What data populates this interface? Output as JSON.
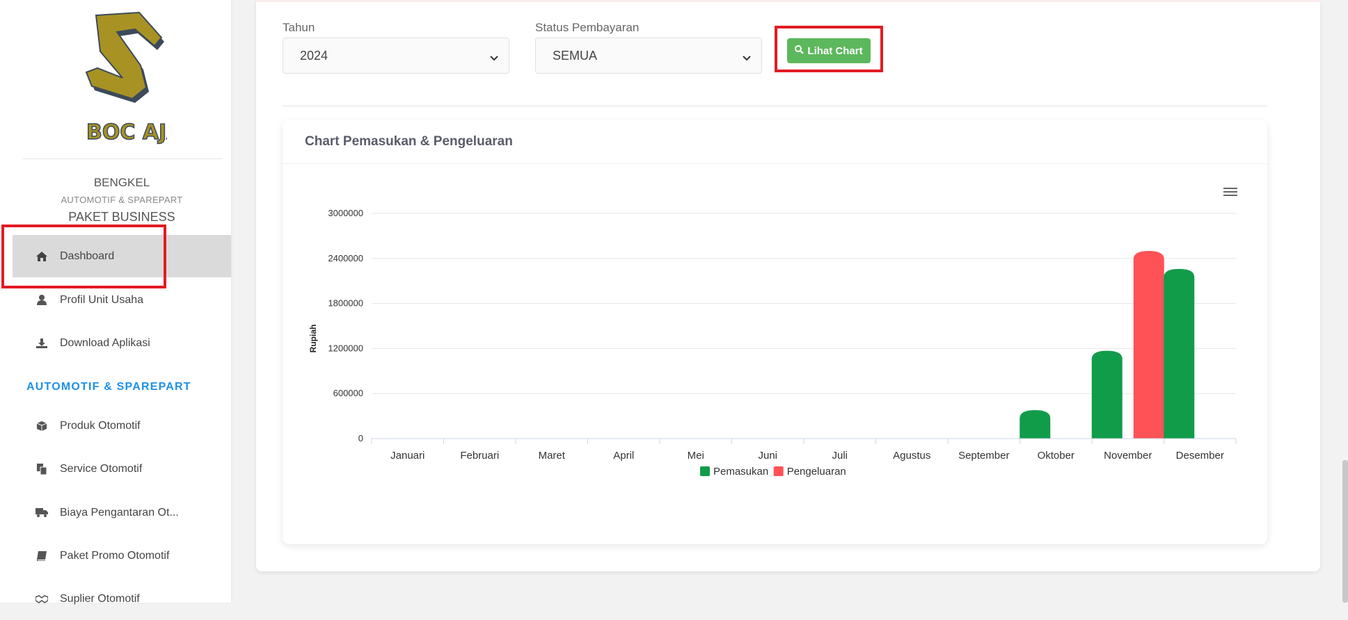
{
  "sidebar": {
    "brand": {
      "name": "BENGKEL",
      "sub": "AUTOMOTIF & SPAREPART",
      "package": "PAKET BUSINESS",
      "logo_text": "BOC AJA"
    },
    "items": [
      {
        "label": "Dashboard",
        "icon": "home-icon"
      },
      {
        "label": "Profil Unit Usaha",
        "icon": "user-icon"
      },
      {
        "label": "Download Aplikasi",
        "icon": "download-icon"
      }
    ],
    "section_title": "AUTOMOTIF & SPAREPART",
    "section_items": [
      {
        "label": "Produk Otomotif",
        "icon": "box-icon"
      },
      {
        "label": "Service Otomotif",
        "icon": "copy-icon"
      },
      {
        "label": "Biaya Pengantaran Ot...",
        "icon": "truck-icon"
      },
      {
        "label": "Paket Promo Otomotif",
        "icon": "book-icon"
      },
      {
        "label": "Suplier Otomotif",
        "icon": "handshake-icon"
      }
    ]
  },
  "filters": {
    "year_label": "Tahun",
    "year_value": "2024",
    "status_label": "Status Pembayaran",
    "status_value": "SEMUA",
    "button_label": "Lihat Chart"
  },
  "chart_card": {
    "title": "Chart Pemasukan & Pengeluaran"
  },
  "chart_data": {
    "type": "bar",
    "categories": [
      "Januari",
      "Februari",
      "Maret",
      "April",
      "Mei",
      "Juni",
      "Juli",
      "Agustus",
      "September",
      "Oktober",
      "November",
      "Desember"
    ],
    "series": [
      {
        "name": "Pemasukan",
        "color": "#119c4a",
        "values": [
          0,
          0,
          0,
          0,
          0,
          0,
          0,
          0,
          0,
          380000,
          1170000,
          2260000
        ]
      },
      {
        "name": "Pengeluaran",
        "color": "#fe5256",
        "values": [
          0,
          0,
          0,
          0,
          0,
          0,
          0,
          0,
          0,
          0,
          2500000,
          0
        ]
      }
    ],
    "ylabel": "Rupiah",
    "ylim": [
      0,
      3000000
    ],
    "yticks": [
      "0",
      "600000",
      "1200000",
      "1800000",
      "2400000",
      "3000000"
    ],
    "legend": "bottom-center",
    "grid": true
  }
}
